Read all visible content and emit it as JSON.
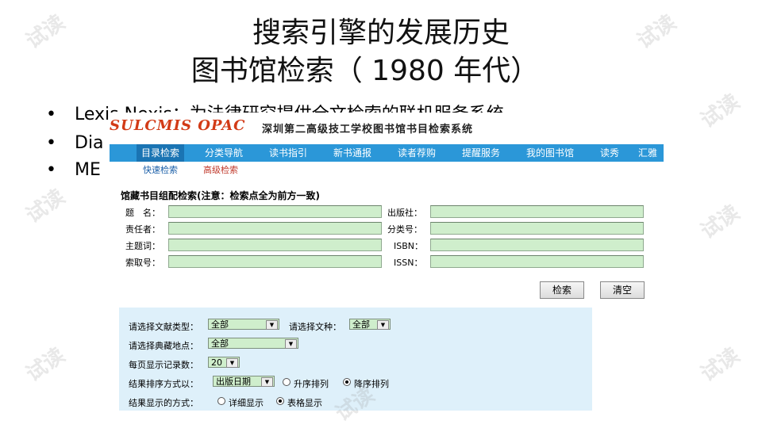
{
  "slide": {
    "title_line1": "搜索引擎的发展历史",
    "title_line2": "图书馆检索（ 1980 年代）",
    "bullets": [
      {
        "dot": "•",
        "text": "Lexis Nexis：为法律研究提供全文检索的联机服务系统"
      },
      {
        "dot": "•",
        "text": "Dia"
      },
      {
        "dot": "•",
        "text": "ME"
      }
    ],
    "watermark": "试读"
  },
  "opac": {
    "logo": "SULCMIS OPAC",
    "system_title": "深圳第二高级技工学校图书馆书目检索系统",
    "nav": [
      "目录检索",
      "分类导航",
      "读书指引",
      "新书通报",
      "读者荐购",
      "提醒服务",
      "我的图书馆",
      "读秀",
      "汇雅"
    ],
    "subnav": [
      "快速检索",
      "高级检索"
    ],
    "form_title": "馆藏书目组配检索(注意：检索点全为前方一致)",
    "fields_left": [
      "题　名：",
      "责任者：",
      "主题词：",
      "索取号："
    ],
    "fields_right": [
      "出版社：",
      "分类号：",
      "ISBN：",
      "ISSN："
    ],
    "search_button": "检索",
    "clear_button": "清空",
    "options": {
      "doc_type_label": "请选择文献类型：",
      "doc_type_value": "全部",
      "lang_label": "请选择文种：",
      "lang_value": "全部",
      "location_label": "请选择典藏地点：",
      "location_value": "全部",
      "per_page_label": "每页显示记录数：",
      "per_page_value": "20",
      "sort_label": "结果排序方式以：",
      "sort_value": "出版日期",
      "sort_asc": "升序排列",
      "sort_desc": "降序排列",
      "display_label": "结果显示的方式：",
      "display_detail": "详细显示",
      "display_table": "表格显示"
    }
  },
  "colors": {
    "navbar": "#2b97d8",
    "logo": "#d23a16",
    "options_bg": "#def0fa",
    "input_bg": "#cfeecc"
  }
}
